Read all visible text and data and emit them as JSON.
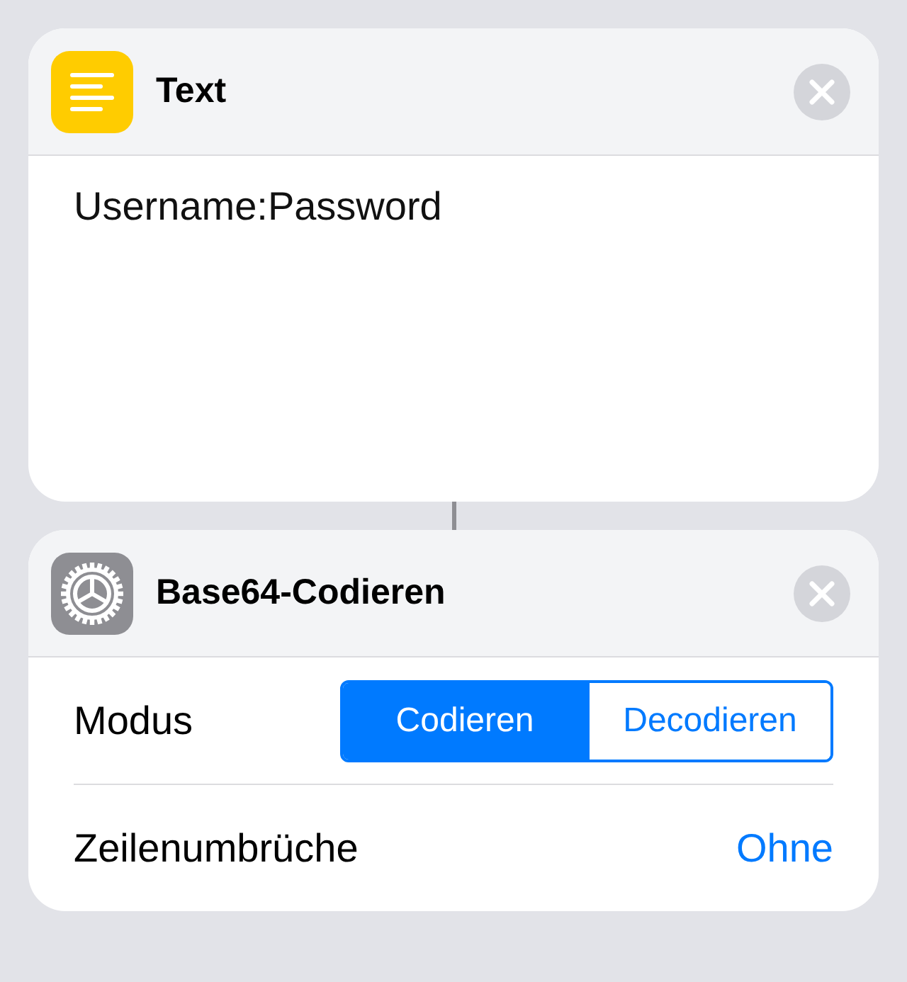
{
  "actions": [
    {
      "kind": "text",
      "title": "Text",
      "content": "Username:Password"
    },
    {
      "kind": "settings",
      "title": "Base64-Codieren",
      "parameters": [
        {
          "kind": "segmented",
          "label": "Modus",
          "options": [
            {
              "label": "Codieren",
              "selected": true
            },
            {
              "label": "Decodieren",
              "selected": false
            }
          ]
        },
        {
          "kind": "value",
          "label": "Zeilenumbrüche",
          "value": "Ohne"
        }
      ]
    }
  ]
}
